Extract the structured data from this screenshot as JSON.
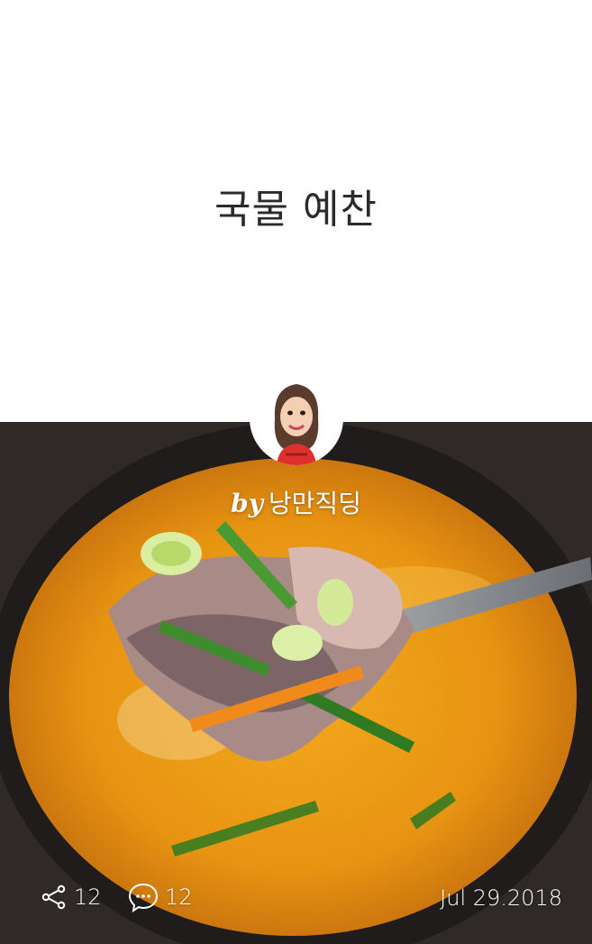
{
  "post": {
    "title": "국물 예찬",
    "by_label": "by",
    "author": "낭만직딩",
    "cover_image": "food-photo",
    "share_count": "12",
    "comment_count": "12",
    "date": "Jul 29.2018"
  },
  "icons": {
    "share": "share-icon",
    "comment": "comment-icon",
    "avatar": "author-avatar"
  }
}
